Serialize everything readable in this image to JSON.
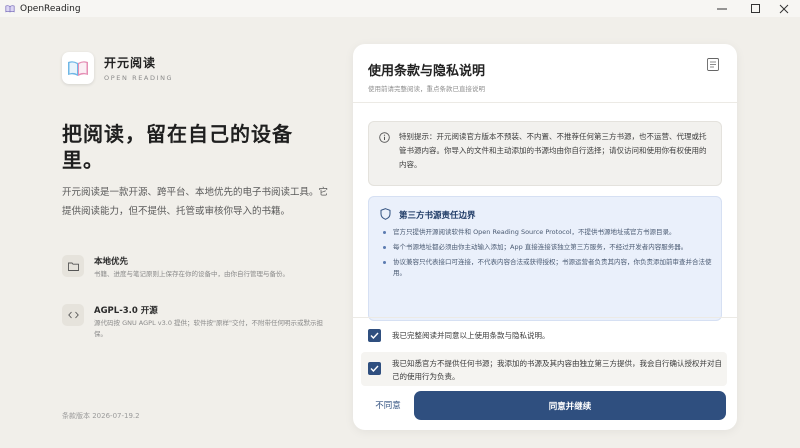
{
  "window": {
    "title": "OpenReading",
    "controls": [
      "minimize",
      "maximize",
      "close"
    ]
  },
  "brand": {
    "name": "开元阅读",
    "subtitle": "OPEN READING",
    "logo_icon": "open-book-icon"
  },
  "hero": {
    "headline": "把阅读，留在自己的设备里。",
    "intro": "开元阅读是一款开源、跨平台、本地优先的电子书阅读工具。它提供阅读能力，但不提供、托管或审核你导入的书籍。"
  },
  "features": [
    {
      "icon": "folder-icon",
      "title": "本地优先",
      "description": "书籍、进度与笔记原则上保存在你的设备中，由你自行管理与备份。"
    },
    {
      "icon": "code-icon",
      "title": "AGPL-3.0 开源",
      "description": "源代码按 GNU AGPL v3.0 提供；软件按\"原样\"交付，不附带任何明示或默示担保。"
    }
  ],
  "footer": {
    "version_text": "条款版本 2026-07-19.2"
  },
  "card": {
    "title": "使用条款与隐私说明",
    "subtitle": "使用前请完整阅读，重点条款已直接说明",
    "notice": {
      "icon": "info-icon",
      "text": "特别提示：开元阅读官方版本不预装、不内置、不推荐任何第三方书源，也不运营、代理或托管书源内容。你导入的文件和主动添加的书源均由你自行选择；请仅访问和使用你有权使用的内容。"
    },
    "boundary": {
      "icon": "shield-icon",
      "title": "第三方书源责任边界",
      "items": [
        "官方只提供开源阅读软件和 Open Reading Source Protocol，不提供书源地址或官方书源目录。",
        "每个书源地址都必须由你主动输入添加；App 直接连接该独立第三方服务，不经过开发者内容服务器。",
        "协议兼容只代表接口可连接，不代表内容合法或获得授权；书源运营者负责其内容，你负责添加前审查并合法使用。"
      ]
    },
    "checkboxes": [
      {
        "label": "我已完整阅读并同意以上使用条款与隐私说明。",
        "checked": true
      },
      {
        "label": "我已知悉官方不提供任何书源；我添加的书源及其内容由独立第三方提供，我会自行确认授权并对自己的使用行为负责。",
        "checked": true
      }
    ],
    "buttons": {
      "decline": "不同意",
      "agree": "同意并继续"
    }
  },
  "colors": {
    "accent": "#2f4f7f",
    "page_background": "#f1efea",
    "boundary_background": "#eaf0fb"
  }
}
